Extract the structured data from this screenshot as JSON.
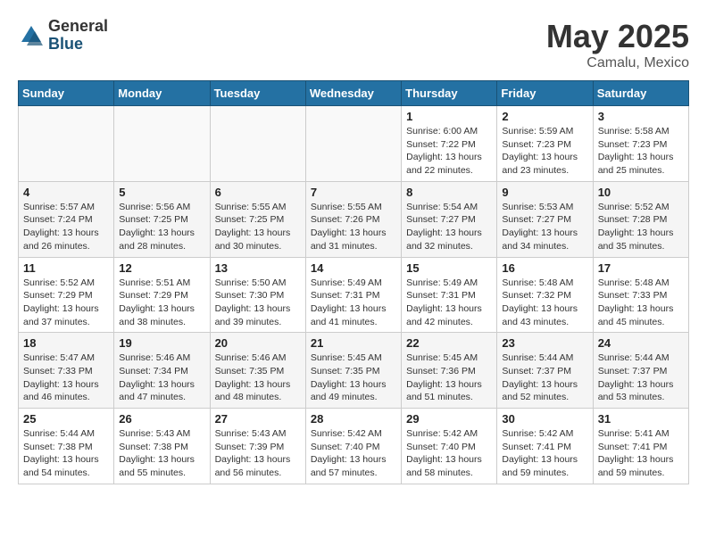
{
  "header": {
    "logo_general": "General",
    "logo_blue": "Blue",
    "month_year": "May 2025",
    "location": "Camalu, Mexico"
  },
  "weekdays": [
    "Sunday",
    "Monday",
    "Tuesday",
    "Wednesday",
    "Thursday",
    "Friday",
    "Saturday"
  ],
  "weeks": [
    [
      {
        "day": "",
        "empty": true
      },
      {
        "day": "",
        "empty": true
      },
      {
        "day": "",
        "empty": true
      },
      {
        "day": "",
        "empty": true
      },
      {
        "day": "1",
        "sunrise": "6:00 AM",
        "sunset": "7:22 PM",
        "daylight": "13 hours and 22 minutes."
      },
      {
        "day": "2",
        "sunrise": "5:59 AM",
        "sunset": "7:23 PM",
        "daylight": "13 hours and 23 minutes."
      },
      {
        "day": "3",
        "sunrise": "5:58 AM",
        "sunset": "7:23 PM",
        "daylight": "13 hours and 25 minutes."
      }
    ],
    [
      {
        "day": "4",
        "sunrise": "5:57 AM",
        "sunset": "7:24 PM",
        "daylight": "13 hours and 26 minutes."
      },
      {
        "day": "5",
        "sunrise": "5:56 AM",
        "sunset": "7:25 PM",
        "daylight": "13 hours and 28 minutes."
      },
      {
        "day": "6",
        "sunrise": "5:55 AM",
        "sunset": "7:25 PM",
        "daylight": "13 hours and 30 minutes."
      },
      {
        "day": "7",
        "sunrise": "5:55 AM",
        "sunset": "7:26 PM",
        "daylight": "13 hours and 31 minutes."
      },
      {
        "day": "8",
        "sunrise": "5:54 AM",
        "sunset": "7:27 PM",
        "daylight": "13 hours and 32 minutes."
      },
      {
        "day": "9",
        "sunrise": "5:53 AM",
        "sunset": "7:27 PM",
        "daylight": "13 hours and 34 minutes."
      },
      {
        "day": "10",
        "sunrise": "5:52 AM",
        "sunset": "7:28 PM",
        "daylight": "13 hours and 35 minutes."
      }
    ],
    [
      {
        "day": "11",
        "sunrise": "5:52 AM",
        "sunset": "7:29 PM",
        "daylight": "13 hours and 37 minutes."
      },
      {
        "day": "12",
        "sunrise": "5:51 AM",
        "sunset": "7:29 PM",
        "daylight": "13 hours and 38 minutes."
      },
      {
        "day": "13",
        "sunrise": "5:50 AM",
        "sunset": "7:30 PM",
        "daylight": "13 hours and 39 minutes."
      },
      {
        "day": "14",
        "sunrise": "5:49 AM",
        "sunset": "7:31 PM",
        "daylight": "13 hours and 41 minutes."
      },
      {
        "day": "15",
        "sunrise": "5:49 AM",
        "sunset": "7:31 PM",
        "daylight": "13 hours and 42 minutes."
      },
      {
        "day": "16",
        "sunrise": "5:48 AM",
        "sunset": "7:32 PM",
        "daylight": "13 hours and 43 minutes."
      },
      {
        "day": "17",
        "sunrise": "5:48 AM",
        "sunset": "7:33 PM",
        "daylight": "13 hours and 45 minutes."
      }
    ],
    [
      {
        "day": "18",
        "sunrise": "5:47 AM",
        "sunset": "7:33 PM",
        "daylight": "13 hours and 46 minutes."
      },
      {
        "day": "19",
        "sunrise": "5:46 AM",
        "sunset": "7:34 PM",
        "daylight": "13 hours and 47 minutes."
      },
      {
        "day": "20",
        "sunrise": "5:46 AM",
        "sunset": "7:35 PM",
        "daylight": "13 hours and 48 minutes."
      },
      {
        "day": "21",
        "sunrise": "5:45 AM",
        "sunset": "7:35 PM",
        "daylight": "13 hours and 49 minutes."
      },
      {
        "day": "22",
        "sunrise": "5:45 AM",
        "sunset": "7:36 PM",
        "daylight": "13 hours and 51 minutes."
      },
      {
        "day": "23",
        "sunrise": "5:44 AM",
        "sunset": "7:37 PM",
        "daylight": "13 hours and 52 minutes."
      },
      {
        "day": "24",
        "sunrise": "5:44 AM",
        "sunset": "7:37 PM",
        "daylight": "13 hours and 53 minutes."
      }
    ],
    [
      {
        "day": "25",
        "sunrise": "5:44 AM",
        "sunset": "7:38 PM",
        "daylight": "13 hours and 54 minutes."
      },
      {
        "day": "26",
        "sunrise": "5:43 AM",
        "sunset": "7:38 PM",
        "daylight": "13 hours and 55 minutes."
      },
      {
        "day": "27",
        "sunrise": "5:43 AM",
        "sunset": "7:39 PM",
        "daylight": "13 hours and 56 minutes."
      },
      {
        "day": "28",
        "sunrise": "5:42 AM",
        "sunset": "7:40 PM",
        "daylight": "13 hours and 57 minutes."
      },
      {
        "day": "29",
        "sunrise": "5:42 AM",
        "sunset": "7:40 PM",
        "daylight": "13 hours and 58 minutes."
      },
      {
        "day": "30",
        "sunrise": "5:42 AM",
        "sunset": "7:41 PM",
        "daylight": "13 hours and 59 minutes."
      },
      {
        "day": "31",
        "sunrise": "5:41 AM",
        "sunset": "7:41 PM",
        "daylight": "13 hours and 59 minutes."
      }
    ]
  ],
  "labels": {
    "sunrise": "Sunrise:",
    "sunset": "Sunset:",
    "daylight": "Daylight:"
  }
}
